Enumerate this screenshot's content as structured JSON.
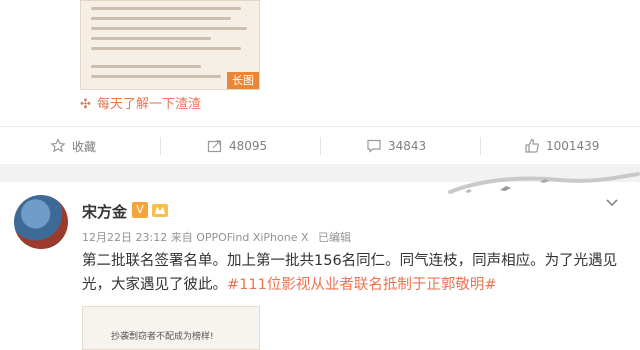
{
  "prev_post": {
    "image_badge": "长图",
    "topic": "每天了解一下渣渣"
  },
  "actions": {
    "favorite": "收藏",
    "repost_count": "48095",
    "comment_count": "34843",
    "like_count": "1001439"
  },
  "post": {
    "author": "宋方金",
    "vip_badge": "V",
    "timestamp": "12月22日 23:12",
    "source": "来自 OPPOFind XiPhone X",
    "edited": "已编辑",
    "text": "第二批联名签署名单。加上第一批共156名同仁。同气连枝，同声相应。为了光遇见光，大家遇见了彼此。",
    "hashtag": "#111位影视从业者联名抵制于正郭敬明#",
    "thumb_text": "抄袭剽窃者不配成为榜样!"
  },
  "colors": {
    "accent": "#eb7350",
    "badge": "#e9863a"
  }
}
